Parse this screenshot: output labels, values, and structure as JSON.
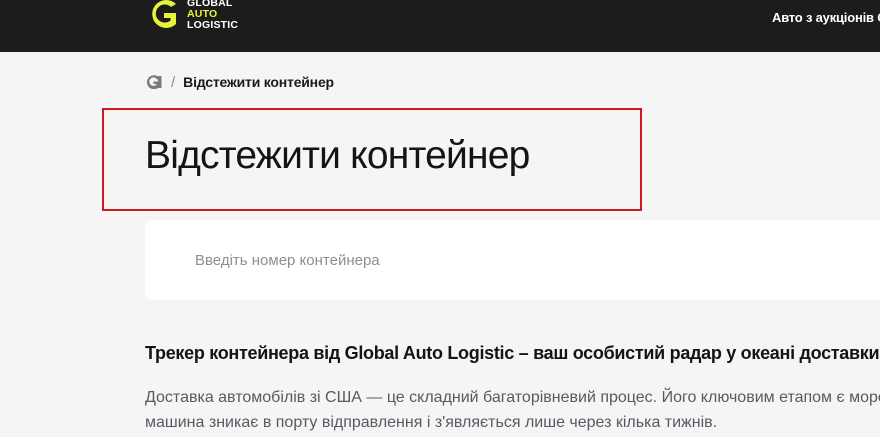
{
  "header": {
    "logo": {
      "line1": "GLOBAL",
      "line2": "AUTO",
      "line3": "LOGISTIC",
      "brand_color": "#e5f43a",
      "icon": "g-logo-icon"
    },
    "nav_link": "Авто з аукціонів США"
  },
  "breadcrumb": {
    "home_icon": "g-home-icon",
    "separator": "/",
    "current": "Відстежити контейнер"
  },
  "page": {
    "title": "Відстежити контейнер",
    "highlight_color": "#d0161f"
  },
  "search": {
    "placeholder": "Введіть номер контейнера",
    "value": ""
  },
  "content": {
    "heading": "Трекер контейнера від Global Auto Logistic – ваш особистий радар у океані доставки",
    "paragraph_line1": "Доставка автомобілів зі США — це складний багаторівневий процес. Його ключовим етапом є морська",
    "paragraph_line2": "машина зникає в порту відправлення і з'являється лише через кілька тижнів."
  }
}
